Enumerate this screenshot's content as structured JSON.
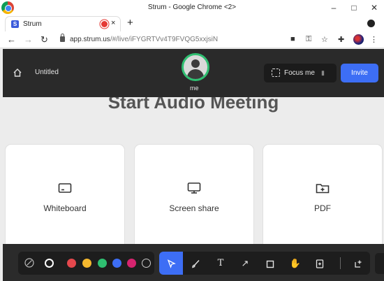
{
  "browser": {
    "window_title": "Strum - Google Chrome <2>",
    "tab": {
      "title": "Strum",
      "close": "×"
    },
    "new_tab": "+",
    "url_host": "app.strum.us",
    "url_path": "/#/live/iFYGRTVv4T9FVQG5xxjsiN",
    "controls": {
      "minimize": "–",
      "maximize": "□",
      "close": "✕"
    }
  },
  "header": {
    "doc_title": "Untitled",
    "user_label": "me",
    "focus_label": "Focus me",
    "invite_label": "Invite"
  },
  "main": {
    "heading": "Start Audio Meeting",
    "cards": [
      {
        "label": "Whiteboard",
        "icon": "whiteboard-icon"
      },
      {
        "label": "Screen share",
        "icon": "monitor-icon"
      },
      {
        "label": "PDF",
        "icon": "folder-plus-icon"
      }
    ]
  },
  "toolbar": {
    "colors": [
      "#e5484d",
      "#f5b82e",
      "#2fbf71",
      "#3d6ef5",
      "#d6246f"
    ],
    "tools": [
      "select",
      "brush",
      "text",
      "arrow",
      "rectangle",
      "hand",
      "add-file",
      "insert-frame"
    ]
  }
}
